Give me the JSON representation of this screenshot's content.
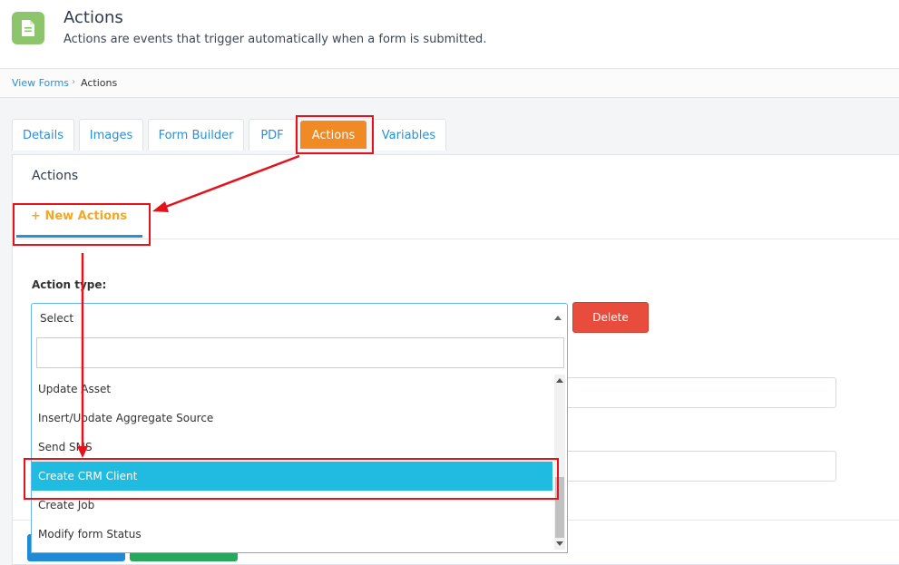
{
  "header": {
    "title": "Actions",
    "subtitle": "Actions are events that trigger automatically when a form is submitted.",
    "icon": "document-icon",
    "icon_color": "#8cc56b"
  },
  "breadcrumb": {
    "link": "View Forms",
    "separator": "›",
    "current": "Actions"
  },
  "tabs": [
    {
      "label": "Details"
    },
    {
      "label": "Images"
    },
    {
      "label": "Form Builder"
    },
    {
      "label": "PDF"
    },
    {
      "label": "Actions",
      "active": true
    },
    {
      "label": "Variables"
    }
  ],
  "panel": {
    "title": "Actions",
    "subtab_label": "New Actions",
    "subtab_icon": "plus-icon"
  },
  "form": {
    "action_type_label": "Action type:",
    "select_value": "Select",
    "delete_label": "Delete",
    "search_value": ""
  },
  "dropdown_options": [
    {
      "label": "Update Asset"
    },
    {
      "label": "Insert/Update Aggregate Source"
    },
    {
      "label": "Send SMS"
    },
    {
      "label": "Create CRM Client",
      "highlighted": true
    },
    {
      "label": "Create Job"
    },
    {
      "label": "Modify form Status"
    }
  ],
  "colors": {
    "accent_orange": "#f08a24",
    "link_blue": "#2b8fd6",
    "highlight": "#1fbbe0",
    "delete_red": "#e74c3c",
    "annotation_red": "#e3121b"
  }
}
